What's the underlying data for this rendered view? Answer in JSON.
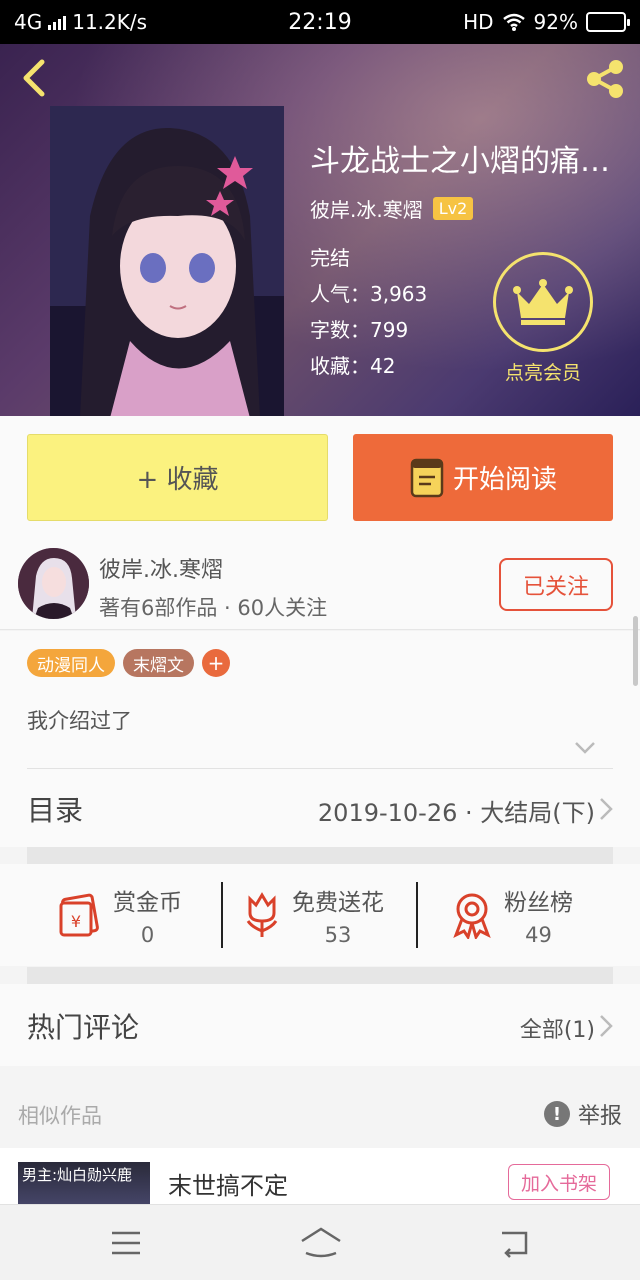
{
  "status_bar": {
    "network": "4G",
    "speed": "11.2K/s",
    "time": "22:19",
    "hd": "HD",
    "battery": "92%",
    "battery_level": 0.92
  },
  "book": {
    "title": "斗龙战士之小熠的痛…",
    "author": "彼岸.冰.寒熠",
    "level": "Lv2",
    "status": "完结",
    "popularity": "人气：3,963",
    "word_count": "字数：799",
    "favorites": "收藏：42",
    "vip_label": "点亮会员"
  },
  "actions": {
    "collect": "+ 收藏",
    "read": "开始阅读"
  },
  "author_card": {
    "name": "彼岸.冰.寒熠",
    "summary": "著有6部作品 · 60人关注",
    "follow": "已关注"
  },
  "tags": [
    {
      "label": "动漫同人",
      "color": "#f4a63c"
    },
    {
      "label": "末熠文",
      "color": "#b77660"
    },
    {
      "label": "+",
      "color": "#e96a3d"
    }
  ],
  "intro": "我介绍过了",
  "toc": {
    "label": "目录",
    "latest": "2019-10-26 · 大结局(下)"
  },
  "rewards": [
    {
      "label": "赏金币",
      "value": "0",
      "icon": "red-envelope-icon"
    },
    {
      "label": "免费送花",
      "value": "53",
      "icon": "flower-icon"
    },
    {
      "label": "粉丝榜",
      "value": "49",
      "icon": "medal-icon"
    }
  ],
  "comments": {
    "label": "热门评论",
    "all": "全部(1)"
  },
  "similar": {
    "label": "相似作品",
    "report": "举报",
    "item_title": "末世搞不定",
    "item_cover_text": "男主:灿白勋兴鹿",
    "add_shelf": "加入书架"
  },
  "colors": {
    "accent_orange": "#ee6a3a",
    "collect_yellow": "#fbf27f",
    "vip_gold": "#f5e36e",
    "follow_red": "#e5523a"
  }
}
